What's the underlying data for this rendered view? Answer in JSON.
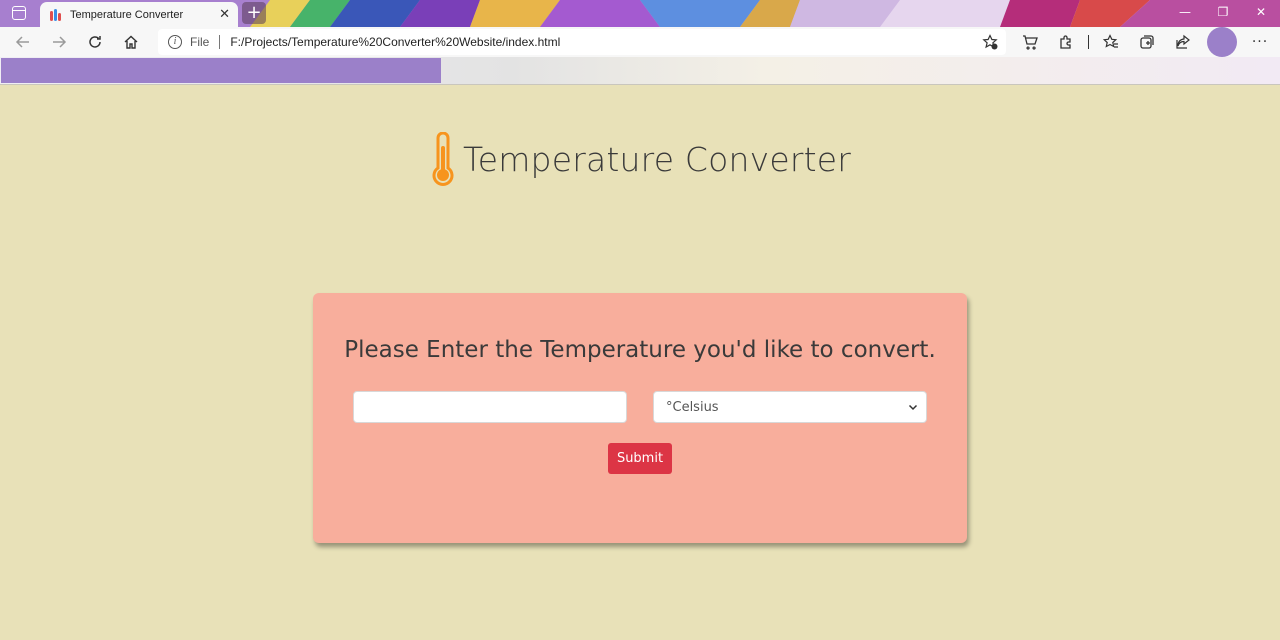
{
  "browser": {
    "tab_title": "Temperature Converter",
    "tab_close": "✕",
    "new_tab": "+",
    "window_controls": [
      "—",
      "❐",
      "✕"
    ],
    "address": {
      "scheme_label": "File",
      "url": "F:/Projects/Temperature%20Converter%20Website/index.html"
    },
    "more_label": "···",
    "colors": {
      "profile_accent": "#9b80c9",
      "favbar_accent": "#9b80c9"
    }
  },
  "page": {
    "title": "Temperature Converter",
    "icon": "thermometer-icon",
    "prompt": "Please Enter the Temperature you'd like to convert.",
    "input": {
      "value": "",
      "placeholder": ""
    },
    "unit_select": {
      "selected": "°Celsius"
    },
    "submit_label": "Submit",
    "colors": {
      "background": "#e8e1b8",
      "card": "#f8ae9c",
      "submit": "#dc3545",
      "icon": "#f7941d"
    }
  }
}
